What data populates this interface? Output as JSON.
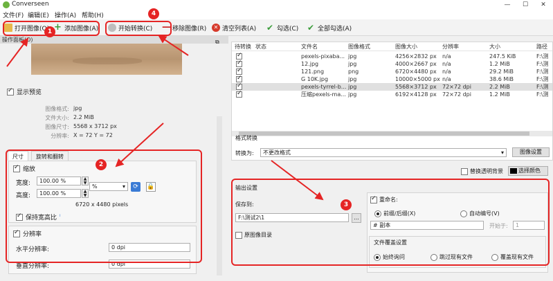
{
  "app": {
    "title": "Converseen"
  },
  "window_controls": {
    "minimize": "—",
    "maximize": "☐",
    "close": "✕"
  },
  "menu": [
    "文件(F)",
    "编辑(E)",
    "操作(A)",
    "帮助(H)"
  ],
  "toolbar": {
    "open": "打开图像(O)",
    "add": "添加图像(A)",
    "start": "开始转换(C)",
    "remove": "移除图像(R)",
    "clear": "清空列表(A)",
    "check": "勾选(C)",
    "check_all": "全部勾选(A)"
  },
  "left": {
    "panel_title": "操作面板(O)",
    "show_preview": "显示预览",
    "info": [
      {
        "label": "图像格式:",
        "value": "jpg"
      },
      {
        "label": "文件大小:",
        "value": "2.2 MiB"
      },
      {
        "label": "图像尺寸:",
        "value": "5568 x 3712 px"
      },
      {
        "label": "分辨率:",
        "value": "X = 72 Y = 72"
      }
    ],
    "tabs": [
      "尺寸",
      "旋转和翻转"
    ],
    "scale_label": "缩放",
    "width_label": "宽度:",
    "width_value": "100.00 %",
    "height_label": "高度:",
    "height_value": "100.00 %",
    "unit": "%",
    "pixels": "6720 x 4480 pixels",
    "keep_ratio": "保持宽高比",
    "resolution_label": "分辨率",
    "h_res_label": "水平分辨率:",
    "h_res_value": "0 dpi",
    "v_res_label": "垂直分辨率:",
    "v_res_value": "0 dpi"
  },
  "table": {
    "headers": [
      "待转换",
      "状态",
      "文件名",
      "图像格式",
      "图像大小",
      "分辨率",
      "大小",
      "路径"
    ],
    "rows": [
      {
        "name": "pexels-pixaba...",
        "fmt": "jpg",
        "size": "4256×2832 px",
        "res": "n/a",
        "bytes": "247.5 KiB",
        "path": "F:\\测",
        "sel": false
      },
      {
        "name": "12.jpg",
        "fmt": "jpg",
        "size": "4000×2667 px",
        "res": "n/a",
        "bytes": "1.2 MiB",
        "path": "F:\\测",
        "sel": false
      },
      {
        "name": "121.png",
        "fmt": "png",
        "size": "6720×4480 px",
        "res": "n/a",
        "bytes": "29.2 MiB",
        "path": "F:\\测",
        "sel": false
      },
      {
        "name": "G 10K.jpg",
        "fmt": "jpg",
        "size": "10000×5000 px",
        "res": "n/a",
        "bytes": "38.6 MiB",
        "path": "F:\\测",
        "sel": false
      },
      {
        "name": "pexels-tyrrel-b...",
        "fmt": "jpg",
        "size": "5568×3712 px",
        "res": "72×72 dpi",
        "bytes": "2.2 MiB",
        "path": "F:\\测",
        "sel": true
      },
      {
        "name": "压缩pexels-ma...",
        "fmt": "jpg",
        "size": "6192×4128 px",
        "res": "72×72 dpi",
        "bytes": "1.2 MiB",
        "path": "F:\\测",
        "sel": false
      }
    ]
  },
  "convert": {
    "section": "格式转换",
    "to_label": "转换为:",
    "to_value": "不更改格式",
    "settings_btn": "图像设置",
    "replace_bg": "替换透明背景",
    "choose_color": "选择颜色"
  },
  "output": {
    "section": "输出设置",
    "save_to": "保存到:",
    "path": "F:\\测试2\\1",
    "browse": "...",
    "orig_dir": "原图像目录",
    "rename": "重命名:",
    "prefix_suffix": "前缀/后缀(X)",
    "auto_number": "自动编号(V)",
    "name_pattern": "# 副本",
    "start_at": "开始于:",
    "start_value": "1",
    "overwrite_title": "文件覆盖设置",
    "ask": "始终询问",
    "skip": "跳过现有文件",
    "overwrite": "覆盖现有文件"
  },
  "badges": [
    "1",
    "2",
    "3",
    "4"
  ],
  "colors": {
    "annotation": "#e52424",
    "accent_green": "#3a9c3a"
  }
}
